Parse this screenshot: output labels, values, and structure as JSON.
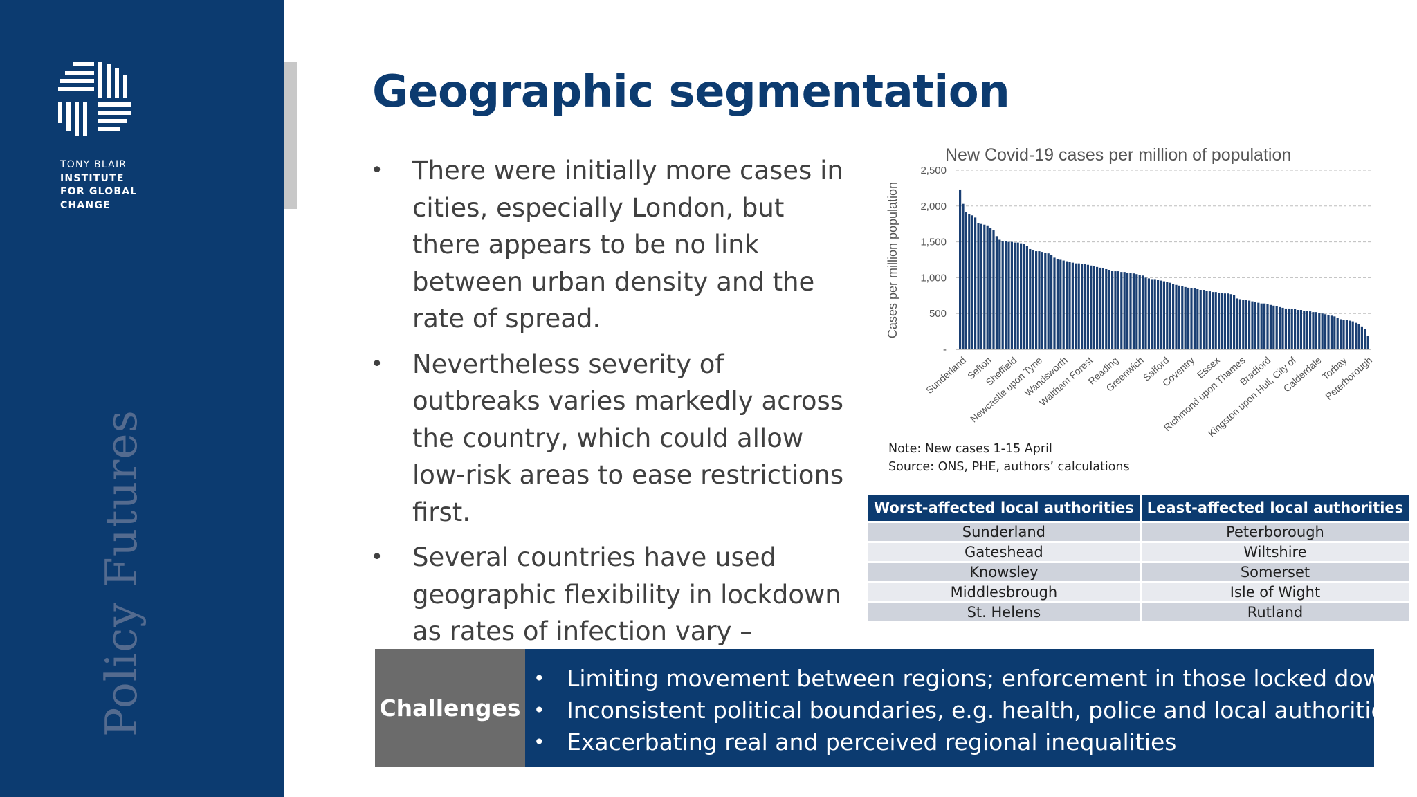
{
  "sidebar": {
    "org_lines": [
      "TONY BLAIR",
      "INSTITUTE",
      "FOR GLOBAL",
      "CHANGE"
    ],
    "series_name": "Policy Futures",
    "logo_icon": "woven-grid-logo-icon"
  },
  "title": "Geographic segmentation",
  "bullets": [
    "There were initially more cases in cities, especially London, but there appears to be no link between urban density and the rate of spread.",
    "Nevertheless severity of outbreaks varies markedly across the country, which could allow low-risk areas to ease restrictions first.",
    "Several countries have used geographic flexibility in lockdown as rates of infection vary – notably the US, Japan and South Korea."
  ],
  "bullet_glyph": "•",
  "chart_data": {
    "type": "bar",
    "title": "New Covid-19 cases per million of population",
    "ylabel": "Cases per million population",
    "xlabel": "",
    "ylim": [
      0,
      2500
    ],
    "yticks": [
      0,
      500,
      1000,
      1500,
      2000,
      2500
    ],
    "ytick_labels": [
      "-",
      "500",
      "1,000",
      "1,500",
      "2,000",
      "2,500"
    ],
    "grid": true,
    "color": "#1a3f73",
    "labeled_categories": [
      "Sunderland",
      "Sefton",
      "Sheffield",
      "Newcastle upon Tyne",
      "Wandsworth",
      "Waltham Forest",
      "Reading",
      "Greenwich",
      "Salford",
      "Coventry",
      "Essex",
      "Richmond upon Thames",
      "Bradford",
      "Kingston upon Hull, City of",
      "Calderdale",
      "Torbay",
      "Peterborough"
    ],
    "values": [
      2230,
      2030,
      1920,
      1890,
      1870,
      1840,
      1760,
      1750,
      1740,
      1730,
      1690,
      1660,
      1580,
      1530,
      1510,
      1510,
      1500,
      1500,
      1490,
      1490,
      1480,
      1470,
      1440,
      1400,
      1380,
      1370,
      1370,
      1360,
      1350,
      1340,
      1320,
      1280,
      1260,
      1250,
      1240,
      1230,
      1220,
      1210,
      1200,
      1200,
      1190,
      1190,
      1180,
      1170,
      1160,
      1150,
      1140,
      1130,
      1120,
      1110,
      1100,
      1090,
      1090,
      1080,
      1080,
      1070,
      1070,
      1060,
      1050,
      1040,
      1030,
      1000,
      990,
      980,
      980,
      970,
      960,
      950,
      940,
      930,
      910,
      900,
      890,
      880,
      870,
      860,
      850,
      850,
      840,
      830,
      830,
      820,
      810,
      800,
      800,
      790,
      790,
      780,
      780,
      770,
      760,
      710,
      700,
      690,
      690,
      680,
      670,
      660,
      650,
      640,
      640,
      630,
      620,
      610,
      600,
      590,
      580,
      570,
      570,
      560,
      560,
      550,
      550,
      540,
      540,
      530,
      520,
      520,
      510,
      500,
      490,
      480,
      470,
      460,
      440,
      420,
      410,
      410,
      400,
      390,
      370,
      350,
      320,
      280,
      190
    ]
  },
  "chart_note": "Note: New cases 1-15 April",
  "chart_source": "Source: ONS, PHE, authors’ calculations",
  "table": {
    "headers": [
      "Worst-affected local authorities",
      "Least-affected local authorities"
    ],
    "rows": [
      [
        "Sunderland",
        "Peterborough"
      ],
      [
        "Gateshead",
        "Wiltshire"
      ],
      [
        "Knowsley",
        "Somerset"
      ],
      [
        "Middlesbrough",
        "Isle of Wight"
      ],
      [
        "St. Helens",
        "Rutland"
      ]
    ]
  },
  "challenges": {
    "label": "Challenges",
    "items": [
      "Limiting movement between regions; enforcement in those locked down",
      "Inconsistent political boundaries, e.g. health, police and local authorities",
      "Exacerbating real and perceived regional inequalities"
    ]
  }
}
